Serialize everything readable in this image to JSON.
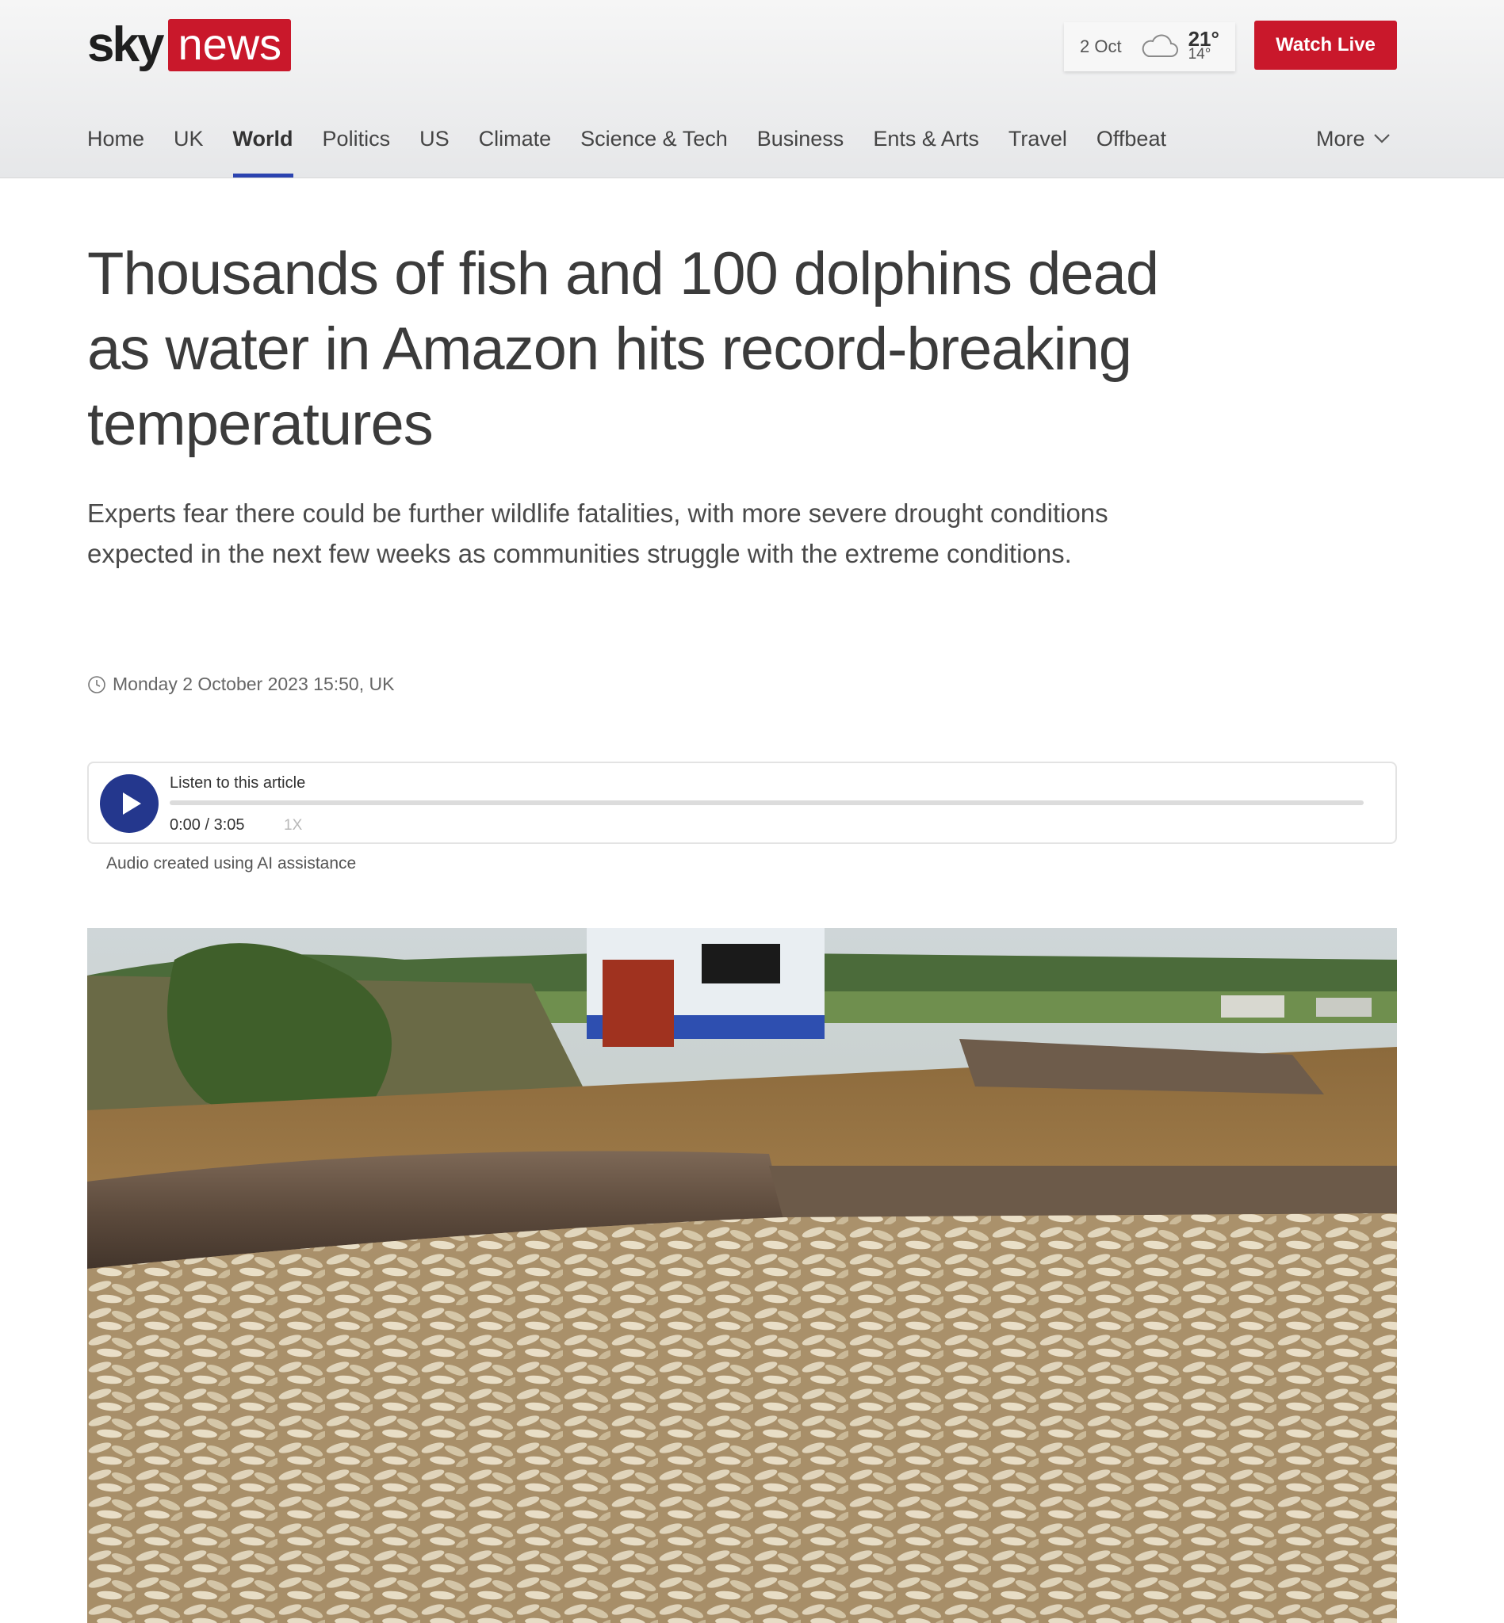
{
  "header": {
    "logo": {
      "sky": "sky",
      "news": "news"
    },
    "weather": {
      "date": "2 Oct",
      "icon": "cloud-icon",
      "high": "21°",
      "low": "14°"
    },
    "watch_live_label": "Watch Live",
    "colors": {
      "brand_red": "#c9182b",
      "accent_blue": "#2b43b0"
    }
  },
  "nav": {
    "items": [
      {
        "label": "Home"
      },
      {
        "label": "UK"
      },
      {
        "label": "World",
        "active": true
      },
      {
        "label": "Politics"
      },
      {
        "label": "US"
      },
      {
        "label": "Climate"
      },
      {
        "label": "Science & Tech"
      },
      {
        "label": "Business"
      },
      {
        "label": "Ents & Arts"
      },
      {
        "label": "Travel"
      },
      {
        "label": "Offbeat"
      }
    ],
    "more_label": "More"
  },
  "article": {
    "headline": "Thousands of fish and 100 dolphins dead as water in Amazon hits record-breaking temperatures",
    "standfirst": "Experts fear there could be further wildlife fatalities, with more severe drought conditions expected in the next few weeks as communities struggle with the extreme conditions.",
    "timestamp": "Monday 2 October 2023 15:50, UK"
  },
  "audio": {
    "title": "Listen to this article",
    "current_time": "0:00",
    "duration": "3:05",
    "time_display": "0:00 / 3:05",
    "speed": "1X",
    "progress": 0,
    "note": "Audio created using AI assistance"
  }
}
